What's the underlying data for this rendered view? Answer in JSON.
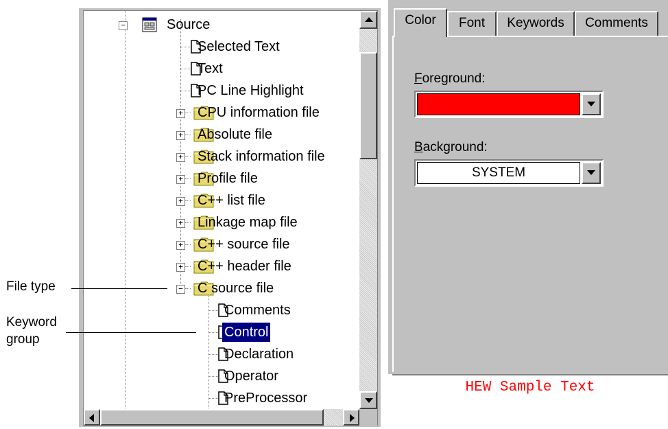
{
  "tree": {
    "root_label": "Source",
    "items": [
      {
        "label": "Selected Text",
        "type": "doc",
        "level": 1
      },
      {
        "label": "Text",
        "type": "doc",
        "level": 1
      },
      {
        "label": "PC Line Highlight",
        "type": "doc",
        "level": 1
      },
      {
        "label": "CPU information file",
        "type": "folder",
        "level": 1,
        "expander": "+"
      },
      {
        "label": "Absolute file",
        "type": "folder",
        "level": 1,
        "expander": "+"
      },
      {
        "label": "Stack information file",
        "type": "folder",
        "level": 1,
        "expander": "+"
      },
      {
        "label": "Profile file",
        "type": "folder",
        "level": 1,
        "expander": "+"
      },
      {
        "label": "C++ list file",
        "type": "folder",
        "level": 1,
        "expander": "+"
      },
      {
        "label": "Linkage map file",
        "type": "folder",
        "level": 1,
        "expander": "+"
      },
      {
        "label": "C++ source file",
        "type": "folder",
        "level": 1,
        "expander": "+"
      },
      {
        "label": "C++ header file",
        "type": "folder",
        "level": 1,
        "expander": "+"
      },
      {
        "label": "C source file",
        "type": "folder",
        "level": 1,
        "expander": "−"
      },
      {
        "label": "Comments",
        "type": "doc",
        "level": 2
      },
      {
        "label": "Control",
        "type": "doc",
        "level": 2,
        "selected": true
      },
      {
        "label": "Declaration",
        "type": "doc",
        "level": 2
      },
      {
        "label": "Operator",
        "type": "doc",
        "level": 2
      },
      {
        "label": "PreProcessor",
        "type": "doc",
        "level": 2
      }
    ]
  },
  "tabs": [
    "Color",
    "Font",
    "Keywords",
    "Comments"
  ],
  "color_tab": {
    "foreground_label_mnemonic": "F",
    "foreground_label_rest": "oreground:",
    "foreground_color": "#ff0000",
    "background_label_mnemonic": "B",
    "background_label_rest": "ackground:",
    "background_value": "SYSTEM"
  },
  "sample_text": "HEW Sample Text",
  "callouts": {
    "file_type": "File type",
    "keyword_group_line1": "Keyword",
    "keyword_group_line2": "group"
  },
  "colors": {
    "window_face": "#c0c0c0",
    "selection": "#000080",
    "folder": "#e8d870",
    "sample_text": "#ff0000"
  }
}
